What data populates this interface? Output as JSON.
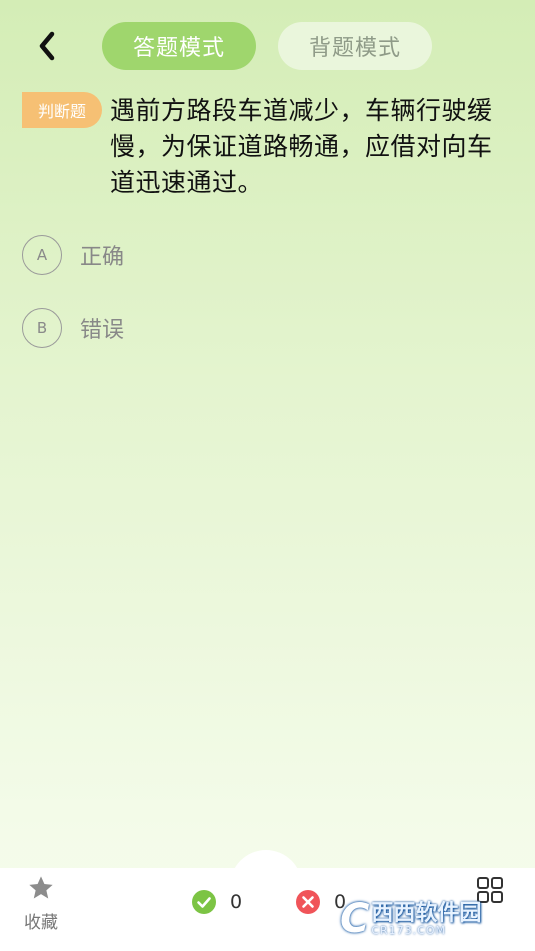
{
  "header": {
    "tabs": [
      {
        "label": "答题模式",
        "active": true
      },
      {
        "label": "背题模式",
        "active": false
      }
    ],
    "back_icon": "chevron-left-icon"
  },
  "question": {
    "type_badge": "判断题",
    "text": "遇前方路段车道减少，车辆行驶缓慢，为保证道路畅通，应借对向车道迅速通过。",
    "options": [
      {
        "letter": "A",
        "text": "正确"
      },
      {
        "letter": "B",
        "text": "错误"
      }
    ]
  },
  "bottom_bar": {
    "favorite_label": "收藏",
    "favorite_icon": "star-icon",
    "correct_count": "0",
    "wrong_count": "0",
    "answer_sheet_icon": "grid-icon"
  },
  "watermark": {
    "logo": "C",
    "main": "西西软件园",
    "sub": "CR173.COM"
  },
  "colors": {
    "accent": "#9fd66d",
    "badge": "#f6c074",
    "correct": "#7cc444",
    "wrong": "#f05459"
  }
}
